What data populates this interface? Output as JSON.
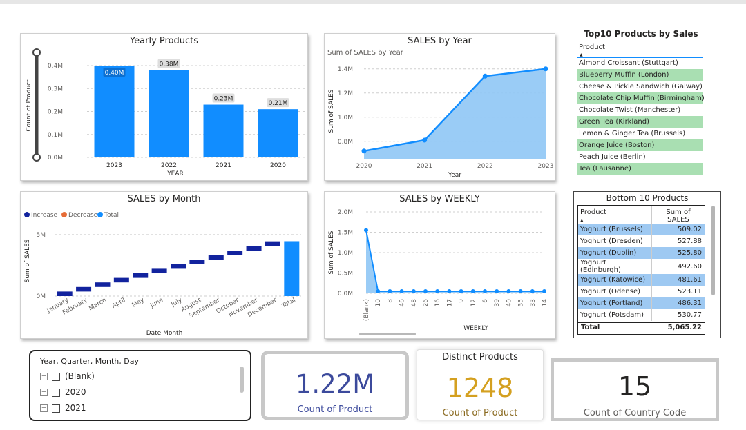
{
  "yearly_products": {
    "title": "Yearly Products",
    "ylabel": "Count of Product",
    "xlabel": "YEAR",
    "y_ticks": [
      "0.0M",
      "0.1M",
      "0.2M",
      "0.3M",
      "0.4M"
    ],
    "bar_labels": [
      "0.40M",
      "0.38M",
      "0.23M",
      "0.21M"
    ]
  },
  "sales_by_year": {
    "title": "SALES by Year",
    "subtitle": "Sum of SALES by Year",
    "ylabel": "Sum of SALES",
    "xlabel": "Year",
    "y_ticks": [
      "0.8M",
      "1.0M",
      "1.2M",
      "1.4M"
    ]
  },
  "top10": {
    "title": "Top10 Products by Sales",
    "header": "Product",
    "items": [
      "Almond Croissant (Stuttgart)",
      "Blueberry Muffin (London)",
      "Cheese & Pickle Sandwich (Galway)",
      "Chocolate Chip Muffin (Birmingham)",
      "Chocolate Twist (Manchester)",
      "Green Tea (Kirkland)",
      "Lemon & Ginger Tea (Brussels)",
      "Orange Juice (Boston)",
      "Peach Juice (Berlin)",
      "Tea (Lausanne)"
    ]
  },
  "sales_by_month": {
    "title": "SALES by Month",
    "legend": [
      "Increase",
      "Decrease",
      "Total"
    ],
    "ylabel": "Sum of SALES",
    "xlabel": "Date Month",
    "y_ticks": [
      "0M",
      "5M"
    ]
  },
  "sales_weekly": {
    "title": "SALES by WEEKLY",
    "ylabel": "Sum of SALES",
    "xlabel": "WEEKLY",
    "y_ticks": [
      "0.0M",
      "0.5M",
      "1.0M",
      "1.5M",
      "2.0M"
    ]
  },
  "bottom10": {
    "title": "Bottom 10 Products",
    "col_product": "Product",
    "col_sales": "Sum of SALES",
    "rows": [
      {
        "product": "Yoghurt (Brussels)",
        "sales": "509.02"
      },
      {
        "product": "Yoghurt (Dresden)",
        "sales": "527.88"
      },
      {
        "product": "Yoghurt (Dublin)",
        "sales": "525.80"
      },
      {
        "product": "Yoghurt (Edinburgh)",
        "sales": "492.60"
      },
      {
        "product": "Yoghurt (Katowice)",
        "sales": "481.61"
      },
      {
        "product": "Yoghurt (Odense)",
        "sales": "523.11"
      },
      {
        "product": "Yoghurt (Portland)",
        "sales": "486.31"
      },
      {
        "product": "Yoghurt (Potsdam)",
        "sales": "530.77"
      }
    ],
    "total_label": "Total",
    "total_value": "5,065.22"
  },
  "slicer": {
    "title": "Year, Quarter, Month, Day",
    "items": [
      "(Blank)",
      "2020",
      "2021"
    ]
  },
  "kpi_count_product": {
    "value": "1.22M",
    "label": "Count of Product",
    "color": "#3c4a9c"
  },
  "kpi_distinct": {
    "title": "Distinct Products",
    "value": "1248",
    "label": "Count of Product",
    "color": "#d4a020"
  },
  "kpi_country": {
    "value": "15",
    "label": "Count of Country Code",
    "color": "#252423"
  },
  "chart_data": [
    {
      "type": "bar",
      "title": "Yearly Products",
      "categories": [
        "2023",
        "2022",
        "2021",
        "2020"
      ],
      "values": [
        0.4,
        0.38,
        0.23,
        0.21
      ],
      "ylabel": "Count of Product",
      "xlabel": "YEAR",
      "ylim": [
        0,
        0.4
      ],
      "color": "#118dff"
    },
    {
      "type": "area",
      "title": "SALES by Year",
      "x": [
        "2020",
        "2021",
        "2022",
        "2023"
      ],
      "values": [
        0.72,
        0.81,
        1.34,
        1.4
      ],
      "ylabel": "Sum of SALES",
      "xlabel": "Year",
      "ylim": [
        0.65,
        1.45
      ],
      "color": "#118dff"
    },
    {
      "type": "bar",
      "title": "SALES by Month",
      "categories": [
        "January",
        "February",
        "March",
        "April",
        "May",
        "June",
        "July",
        "August",
        "September",
        "October",
        "November",
        "December",
        "Total"
      ],
      "values": [
        0.37,
        0.37,
        0.37,
        0.37,
        0.37,
        0.37,
        0.37,
        0.37,
        0.37,
        0.37,
        0.37,
        0.38,
        4.46
      ],
      "ylabel": "Sum of SALES",
      "xlabel": "Date Month",
      "ylim": [
        0,
        6
      ],
      "colors": {
        "Increase": "#12239e",
        "Decrease": "#e66c37",
        "Total": "#118dff"
      }
    },
    {
      "type": "area",
      "title": "SALES by WEEKLY",
      "x": [
        "(Blank)",
        "10",
        "8",
        "46",
        "48",
        "26",
        "16",
        "17",
        "9",
        "12",
        "6",
        "39",
        "40",
        "35",
        "33",
        "14"
      ],
      "values": [
        1.55,
        0.05,
        0.05,
        0.05,
        0.05,
        0.05,
        0.05,
        0.05,
        0.05,
        0.05,
        0.05,
        0.05,
        0.05,
        0.05,
        0.05,
        0.05
      ],
      "ylabel": "Sum of SALES",
      "xlabel": "WEEKLY",
      "ylim": [
        0,
        2.0
      ],
      "color": "#118dff"
    }
  ]
}
